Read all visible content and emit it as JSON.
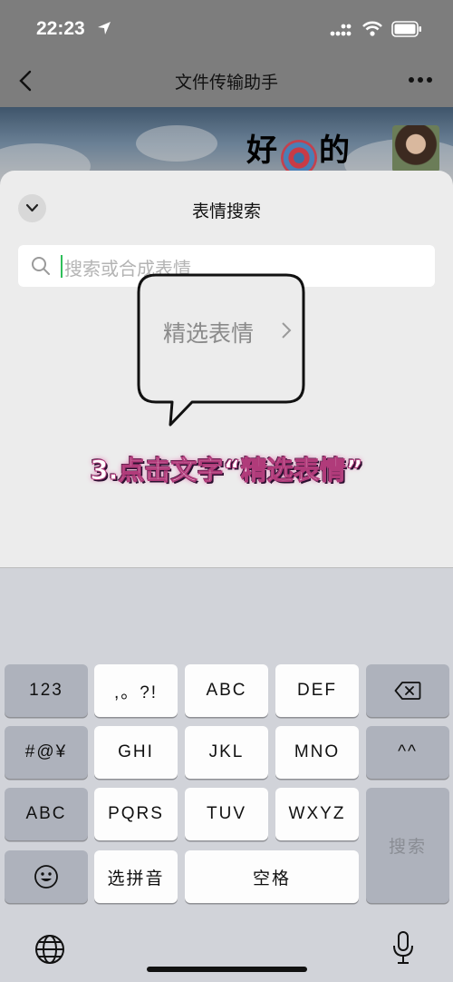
{
  "status_bar": {
    "time": "22:23"
  },
  "chat": {
    "title": "文件传输助手",
    "message_char_1": "好",
    "message_char_2": "的"
  },
  "sheet": {
    "title": "表情搜索",
    "search_placeholder": "搜索或合成表情"
  },
  "overlay": {
    "bubble_text": "精选表情",
    "annotation": "3.点击文字“精选表情”"
  },
  "keyboard": {
    "keys": {
      "numbers": "123",
      "punct": ",。?!",
      "abc": "ABC",
      "def": "DEF",
      "symbols": "#@¥",
      "ghi": "GHI",
      "jkl": "JKL",
      "mno": "MNO",
      "caret": "^^",
      "switch_abc": "ABC",
      "pqrs": "PQRS",
      "tuv": "TUV",
      "wxyz": "WXYZ",
      "search": "搜索",
      "pinyin": "选拼音",
      "space": "空格"
    },
    "icons": [
      "delete-icon",
      "emoji-icon",
      "globe-icon",
      "microphone-icon"
    ]
  },
  "colors": {
    "accent_caret": "#2fbf5a",
    "annotation_pink": "#e15ca5"
  }
}
